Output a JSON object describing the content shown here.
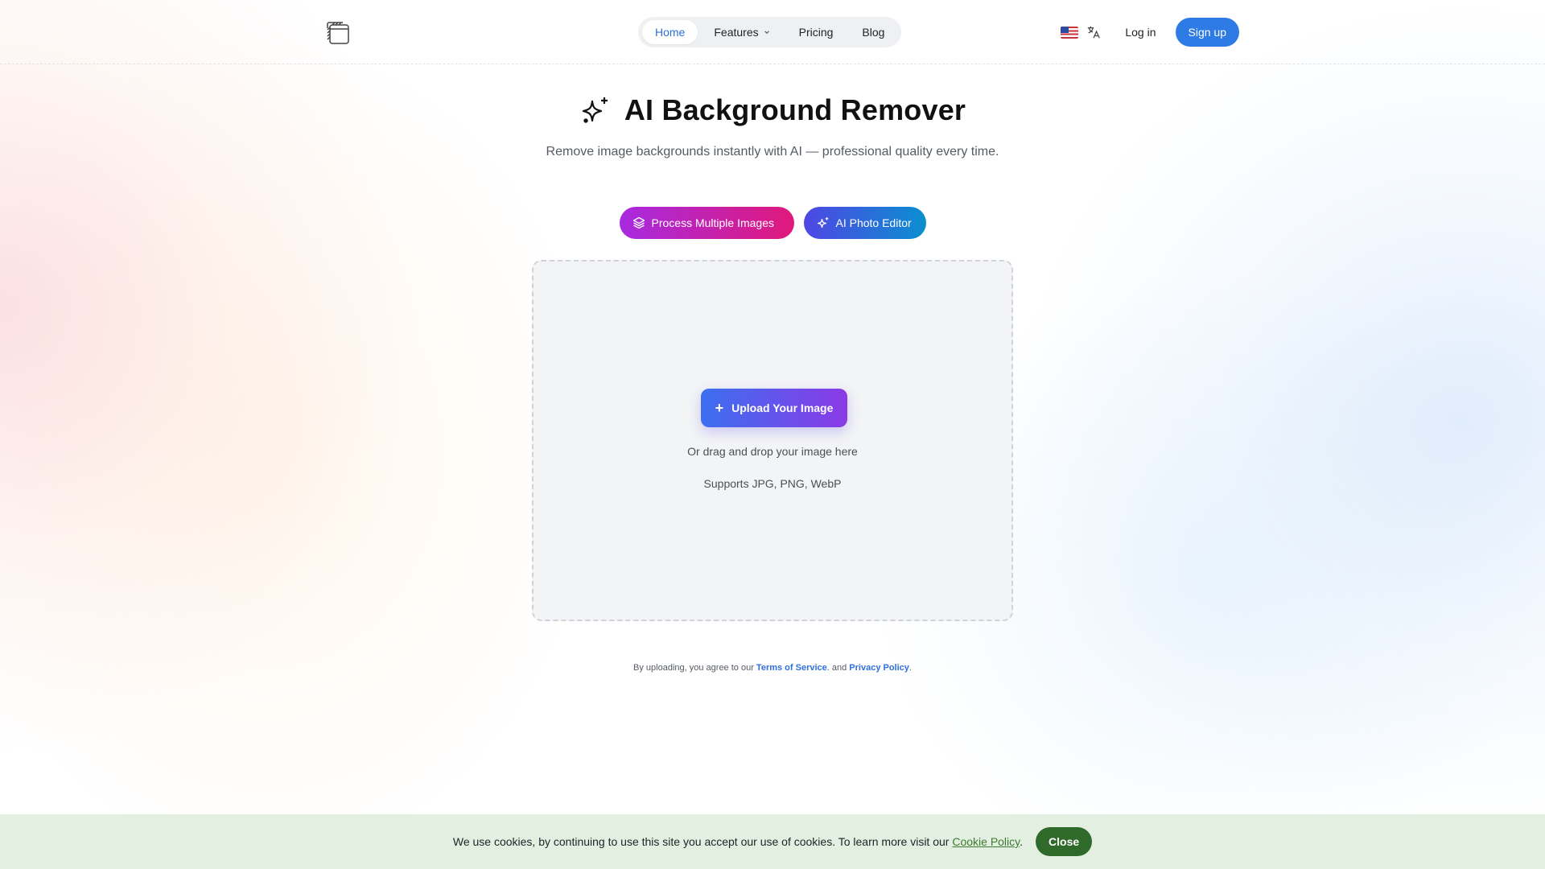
{
  "header": {
    "nav": [
      {
        "label": "Home",
        "active": true
      },
      {
        "label": "Features",
        "has_dropdown": true
      },
      {
        "label": "Pricing"
      },
      {
        "label": "Blog"
      }
    ],
    "language_flag": "us-flag-icon",
    "login_label": "Log in",
    "signup_label": "Sign up"
  },
  "hero": {
    "title": "AI Background Remover",
    "subtitle": "Remove image backgrounds instantly with AI — professional quality every time."
  },
  "actions": {
    "multi_label": "Process Multiple Images",
    "editor_label": "AI Photo Editor"
  },
  "dropzone": {
    "upload_label": "Upload Your Image",
    "hint": "Or drag and drop your image here",
    "supports": "Supports JPG, PNG, WebP"
  },
  "terms": {
    "prefix": "By uploading, you agree to our",
    "tos_label": "Terms of Service",
    "middle": ". and",
    "privacy_label": "Privacy Policy",
    "suffix": "."
  },
  "cookie": {
    "text": "We use cookies, by continuing to use this site you accept our use of cookies. To learn more visit our",
    "link_label": "Cookie Policy",
    "suffix": ".",
    "close_label": "Close"
  },
  "colors": {
    "accent": "#2f7be5",
    "nav_active": "#2f6fde",
    "cookie_bg": "#e3efe0",
    "cookie_button": "#2f6a2a"
  }
}
